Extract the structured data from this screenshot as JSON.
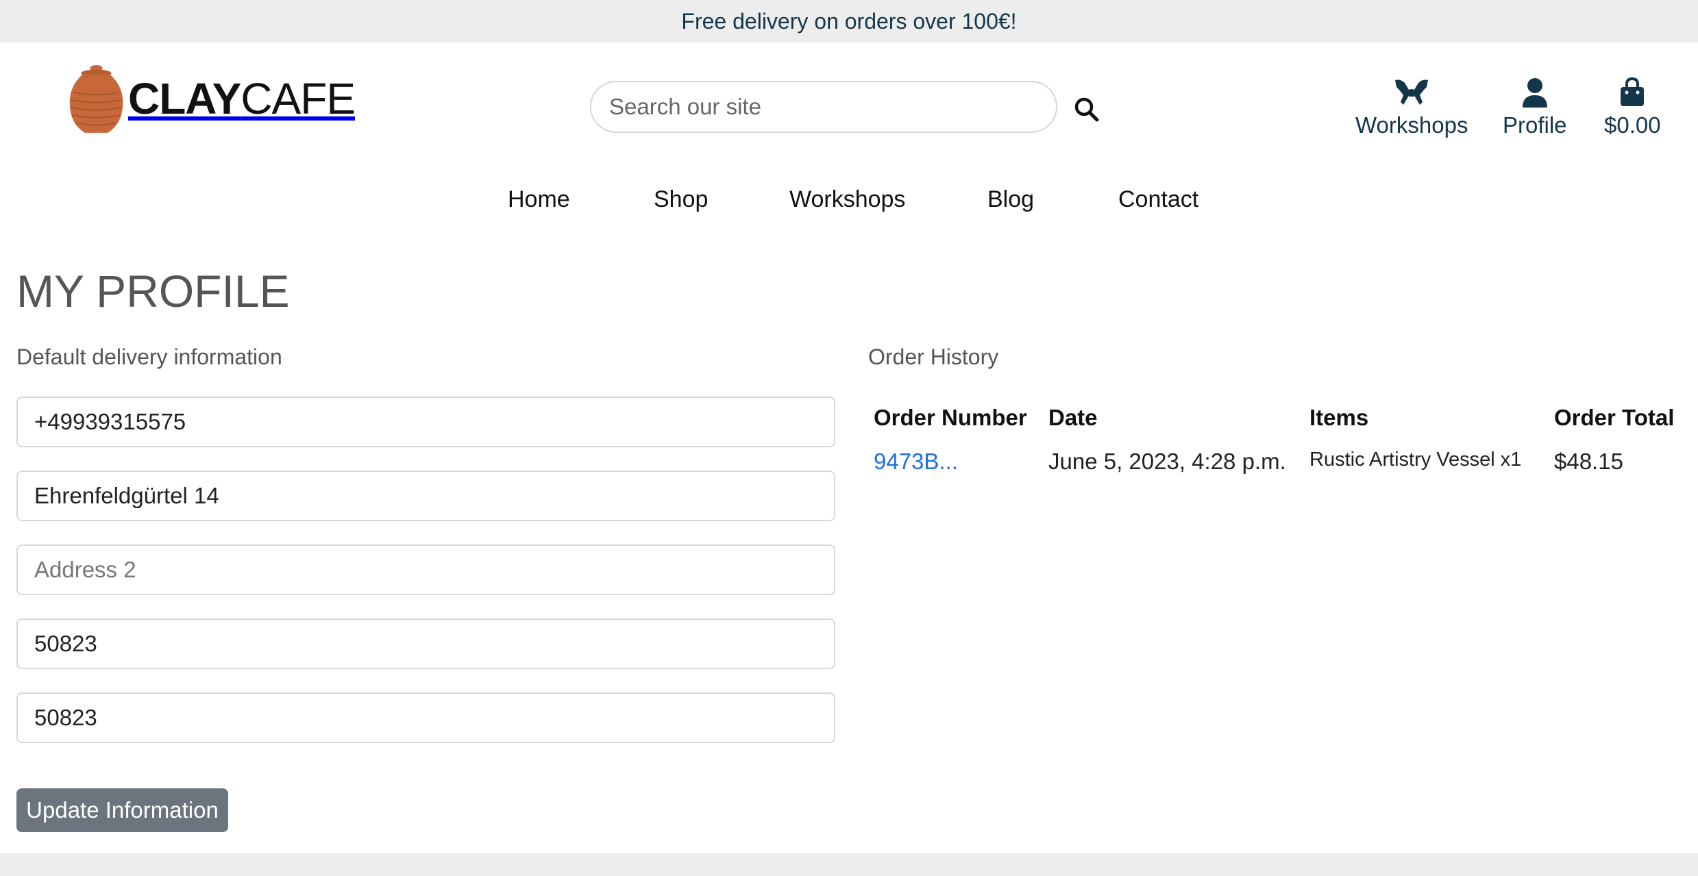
{
  "banner": {
    "text": "Free delivery on orders over 100€!"
  },
  "logo": {
    "bold": "CLAY",
    "light": "CAFE"
  },
  "search": {
    "placeholder": "Search our site"
  },
  "header_links": {
    "workshops": "Workshops",
    "profile": "Profile",
    "cart_total": "$0.00"
  },
  "nav": [
    "Home",
    "Shop",
    "Workshops",
    "Blog",
    "Contact"
  ],
  "page_title": "MY PROFILE",
  "delivery": {
    "heading": "Default delivery information",
    "phone": "+49939315575",
    "address1": "Ehrenfeldgürtel 14",
    "address2_placeholder": "Address 2",
    "field4": "50823",
    "field5": "50823",
    "button": "Update Information"
  },
  "orders": {
    "heading": "Order History",
    "columns": [
      "Order Number",
      "Date",
      "Items",
      "Order Total"
    ],
    "rows": [
      {
        "number": "9473B...",
        "date": "June 5, 2023, 4:28 p.m.",
        "items": "Rustic Artistry Vessel x1",
        "total": "$48.15"
      }
    ]
  },
  "colors": {
    "brand_navy": "#14364a",
    "logo_pot": "#c8683a",
    "button_grey": "#6c757d",
    "link_blue": "#1f6fe0"
  }
}
